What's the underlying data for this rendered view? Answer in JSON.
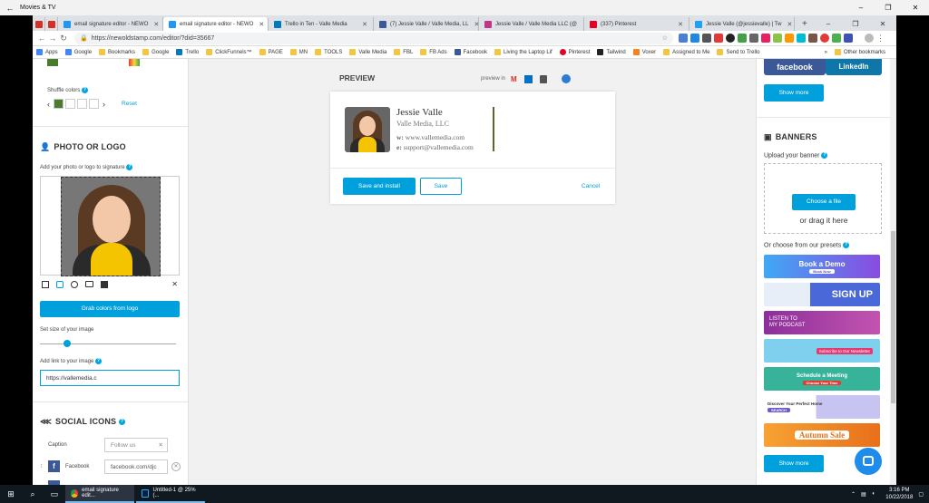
{
  "tvbar": {
    "title": "Movies & TV"
  },
  "browser": {
    "tabs": [
      {
        "label": "",
        "color": "#d93025"
      },
      {
        "label": "",
        "color": "#d93025"
      },
      {
        "label": "email signature editor - NEWO",
        "color": "#2196f3"
      },
      {
        "label": "email signature editor - NEWO",
        "color": "#2196f3"
      },
      {
        "label": "Trello in Ten - Valle Media",
        "color": "#0079bf"
      },
      {
        "label": "(7) Jessie Valle / Valle Media, LL",
        "color": "#3b5998"
      },
      {
        "label": "Jessie Valle / Valle Media LLC (@",
        "color": "#c13584"
      },
      {
        "label": "(337) Pinterest",
        "color": "#e60023"
      },
      {
        "label": "Jessie Valle (@jessievalle) | Tw",
        "color": "#1da1f2"
      }
    ],
    "url": "https://newoldstamp.com/editor/?did=35667",
    "bookmarks": [
      {
        "label": "Apps",
        "color": "#4285f4"
      },
      {
        "label": "Google",
        "color": "#4285f4"
      },
      {
        "label": "Bookmarks",
        "color": "#f4c542"
      },
      {
        "label": "Google",
        "color": "#f4c542"
      },
      {
        "label": "Trello",
        "color": "#0079bf"
      },
      {
        "label": "ClickFunnels™",
        "color": "#f4c542"
      },
      {
        "label": "PAGE",
        "color": "#f4c542"
      },
      {
        "label": "MN",
        "color": "#f4c542"
      },
      {
        "label": "TOOLS",
        "color": "#f4c542"
      },
      {
        "label": "Valle Media",
        "color": "#f4c542"
      },
      {
        "label": "FBL",
        "color": "#f4c542"
      },
      {
        "label": "FB Ads",
        "color": "#f4c542"
      },
      {
        "label": "Facebook",
        "color": "#3b5998"
      },
      {
        "label": "Living the Laptop Lif",
        "color": "#f4c542"
      },
      {
        "label": "Pinterest",
        "color": "#e60023"
      },
      {
        "label": "Tailwind",
        "color": "#222"
      },
      {
        "label": "Voxer",
        "color": "#f58220"
      },
      {
        "label": "Assigned to Me",
        "color": "#f4c542"
      },
      {
        "label": "Send to Trello",
        "color": "#f4c542"
      }
    ],
    "other_bookmarks": "Other bookmarks"
  },
  "left": {
    "shuffle_label": "Shuffle colors",
    "reset": "Reset",
    "photo_heading": "PHOTO OR LOGO",
    "add_photo_label": "Add your photo or logo to signature",
    "grab_colors": "Grab colors from logo",
    "size_label": "Set size of your image",
    "size_value": 0.2,
    "link_label": "Add link to your image",
    "link_value": "https://vallemedia.c",
    "social_heading": "SOCIAL ICONS",
    "caption_label": "Caption",
    "caption_placeholder": "Follow us",
    "facebook_label": "Facebook",
    "facebook_value": "facebook.com/djc"
  },
  "preview": {
    "title": "PREVIEW",
    "preview_in": "preview in",
    "name": "Jessie Valle",
    "company": "Valle Media, LLC",
    "w_label": "w:",
    "website": "www.vallemedia.com",
    "e_label": "e:",
    "email": "support@vallemedia.com",
    "save_install": "Save and install",
    "save": "Save",
    "cancel": "Cancel"
  },
  "right": {
    "facebook": "facebook",
    "linkedin": "LinkedIn",
    "show_more_1": "Show more",
    "banners_heading": "BANNERS",
    "upload_label": "Upload your banner",
    "choose_file": "Choose a file",
    "drag_here": "or drag it here",
    "presets_label": "Or choose from our presets",
    "banners": [
      {
        "text": "Book a Demo",
        "sub": "Book Now",
        "color": "#3fa9f5"
      },
      {
        "text": "SIGN UP",
        "sub": "",
        "color": "#4a68d8"
      },
      {
        "text": "LISTEN TO MY PODCAST",
        "sub": "",
        "color": "#9b3fa0"
      },
      {
        "text": "Subscribe to Our Newsletter",
        "sub": "",
        "color": "#5ec5e8"
      },
      {
        "text": "Schedule a Meeting",
        "sub": "Choose Your Time",
        "color": "#37b39a"
      },
      {
        "text": "Discover Your Perfect Home",
        "sub": "SEARCH",
        "color": "#ffffff"
      },
      {
        "text": "Autumn Sale",
        "sub": "",
        "color": "#f28a1e"
      }
    ],
    "show_more_2": "Show more"
  },
  "taskbar": {
    "app1": "email signature edit...",
    "app2": "Untitled-1 @ 25% (...",
    "time": "3:16 PM",
    "date": "10/22/2018"
  }
}
